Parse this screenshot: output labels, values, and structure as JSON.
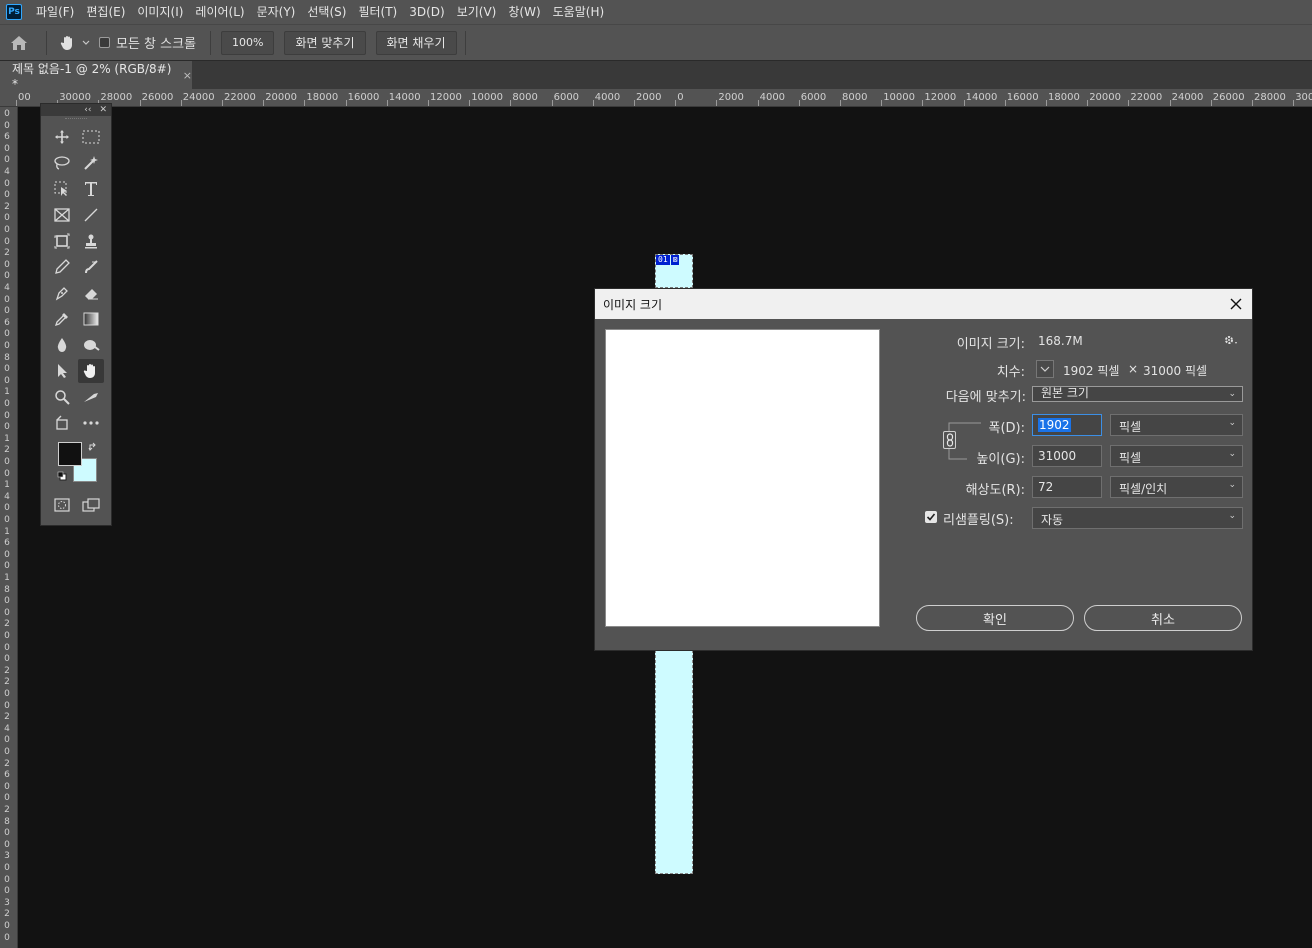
{
  "menubar": {
    "logo": "Ps",
    "items": [
      "파일(F)",
      "편집(E)",
      "이미지(I)",
      "레이어(L)",
      "문자(Y)",
      "선택(S)",
      "필터(T)",
      "3D(D)",
      "보기(V)",
      "창(W)",
      "도움말(H)"
    ]
  },
  "options": {
    "scroll_all_label": "모든 창 스크롤",
    "zoom_value": "100%",
    "fit_screen_label": "화면 맞추기",
    "fill_screen_label": "화면 채우기"
  },
  "document_tab": {
    "title": "제목 없음-1 @ 2% (RGB/8#) *",
    "close": "×"
  },
  "ruler_h_labels": [
    "00",
    "30000",
    "28000",
    "26000",
    "24000",
    "22000",
    "20000",
    "18000",
    "16000",
    "14000",
    "12000",
    "10000",
    "8000",
    "6000",
    "4000",
    "2000",
    "0",
    "2000",
    "4000",
    "6000",
    "8000",
    "10000",
    "12000",
    "14000",
    "16000",
    "18000",
    "20000",
    "22000",
    "24000",
    "26000",
    "28000",
    "30000"
  ],
  "ruler_v_labels": [
    "0",
    "0",
    "6",
    "0",
    "0",
    "4",
    "0",
    "0",
    "2",
    "0",
    "0",
    "0",
    "2",
    "0",
    "0",
    "4",
    "0",
    "0",
    "6",
    "0",
    "0",
    "8",
    "0",
    "0",
    "1",
    "0",
    "0",
    "0",
    "1",
    "2",
    "0",
    "0",
    "1",
    "4",
    "0",
    "0",
    "1",
    "6",
    "0",
    "0",
    "1",
    "8",
    "0",
    "0",
    "2",
    "0",
    "0",
    "0",
    "2",
    "2",
    "0",
    "0",
    "2",
    "4",
    "0",
    "0",
    "2",
    "6",
    "0",
    "0",
    "2",
    "8",
    "0",
    "0",
    "3",
    "0",
    "0",
    "0",
    "3",
    "2",
    "0",
    "0"
  ],
  "slice_badge": [
    "01",
    "⊠"
  ],
  "dialog": {
    "title": "이미지 크기",
    "image_size_label": "이미지 크기:",
    "image_size_value": "168.7M",
    "dimensions_label": "치수:",
    "dim_width": "1902 픽셀",
    "dim_times": "×",
    "dim_height": "31000 픽셀",
    "fit_to_label": "다음에 맞추기:",
    "fit_to_value": "원본 크기",
    "width_label": "폭(D):",
    "width_value": "1902",
    "width_unit": "픽셀",
    "height_label": "높이(G):",
    "height_value": "31000",
    "height_unit": "픽셀",
    "resolution_label": "해상도(R):",
    "resolution_value": "72",
    "resolution_unit": "픽셀/인치",
    "resample_label": "리샘플링(S):",
    "resample_checked": true,
    "resample_value": "자동",
    "ok_label": "확인",
    "cancel_label": "취소"
  },
  "colors": {
    "foreground": "#111111",
    "background": "#cefbff"
  }
}
